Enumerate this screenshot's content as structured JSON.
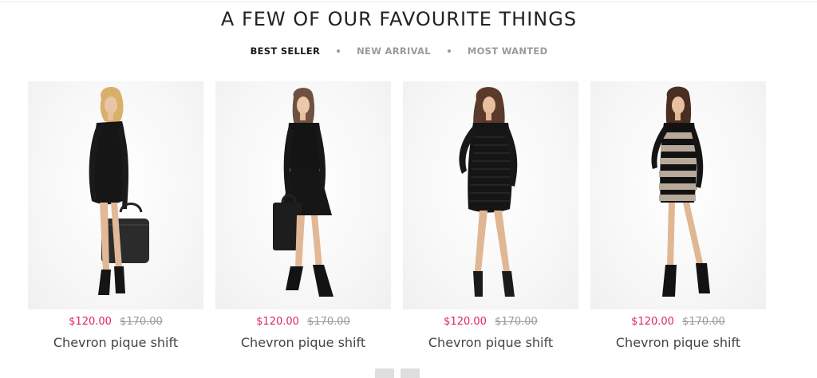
{
  "section": {
    "title": "A FEW OF OUR FAVOURITE THINGS"
  },
  "tabs": [
    {
      "label": "BEST SELLER",
      "active": true
    },
    {
      "label": "NEW ARRIVAL",
      "active": false
    },
    {
      "label": "MOST WANTED",
      "active": false
    }
  ],
  "colors": {
    "accent_price": "#e0245e",
    "old_price": "#9a9a9a"
  },
  "products": [
    {
      "name": "Chevron pique shift",
      "price": "$120.00",
      "old_price": "$170.00",
      "image": "model-black-dress-handbag-image"
    },
    {
      "name": "Chevron pique shift",
      "price": "$120.00",
      "old_price": "$170.00",
      "image": "model-black-dress-tote-image"
    },
    {
      "name": "Chevron pique shift",
      "price": "$120.00",
      "old_price": "$170.00",
      "image": "model-black-knit-dress-image"
    },
    {
      "name": "Chevron pique shift",
      "price": "$120.00",
      "old_price": "$170.00",
      "image": "model-sequin-stripe-dress-image"
    }
  ],
  "pager": {
    "icons": [
      "prev-icon",
      "next-icon"
    ]
  }
}
